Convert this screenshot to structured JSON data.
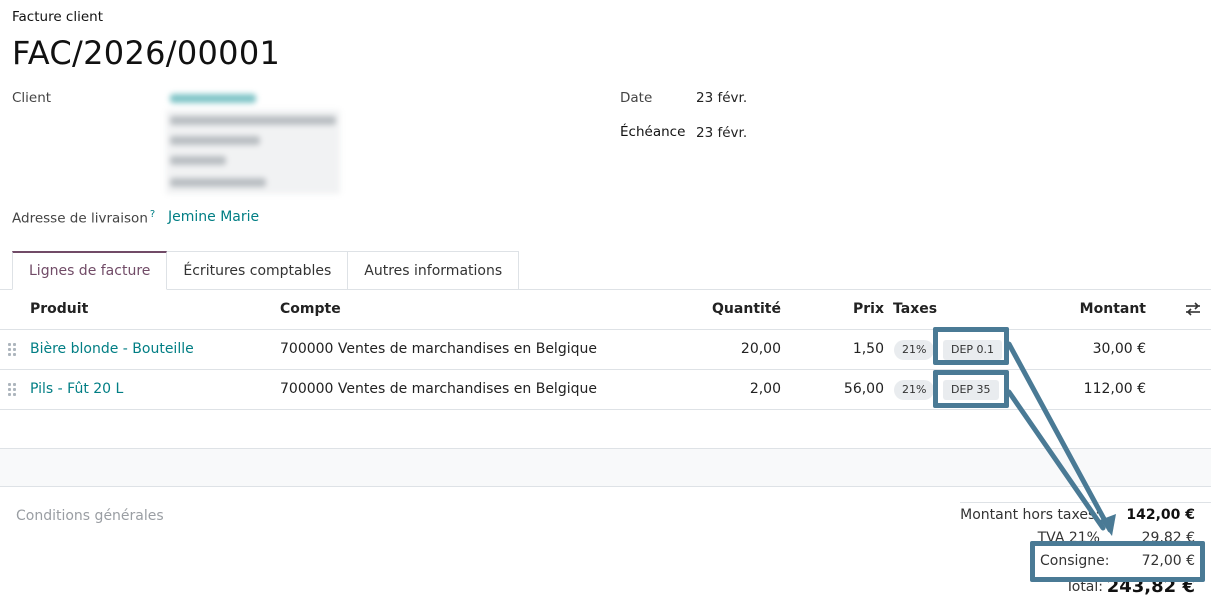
{
  "header": {
    "doc_type": "Facture client",
    "title": "FAC/2026/00001"
  },
  "fields": {
    "client_label": "Client",
    "client_name": "Jemine Marie",
    "date_label": "Date",
    "date_value": "23 févr.",
    "due_label": "Échéance",
    "due_value": "23 févr.",
    "delivery_label": "Adresse de livraison",
    "delivery_help": "?",
    "delivery_value": "Jemine Marie"
  },
  "tabs": [
    {
      "label": "Lignes de facture",
      "active": true
    },
    {
      "label": "Écritures comptables",
      "active": false
    },
    {
      "label": "Autres informations",
      "active": false
    }
  ],
  "table": {
    "columns": {
      "product": "Produit",
      "account": "Compte",
      "quantity": "Quantité",
      "price": "Prix",
      "taxes": "Taxes",
      "amount": "Montant"
    },
    "rows": [
      {
        "product": "Bière blonde - Bouteille",
        "account": "700000 Ventes de marchandises en Belgique",
        "quantity": "20,00",
        "price": "1,50",
        "tax": "21%",
        "deposit": "DEP 0.1",
        "amount": "30,00 €"
      },
      {
        "product": "Pils - Fût 20 L",
        "account": "700000 Ventes de marchandises en Belgique",
        "quantity": "2,00",
        "price": "56,00",
        "tax": "21%",
        "deposit": "DEP 35",
        "amount": "112,00 €"
      }
    ]
  },
  "footer": {
    "conditions_placeholder": "Conditions générales"
  },
  "totals": {
    "untaxed_label": "Montant hors taxes:",
    "untaxed_value": "142,00 €",
    "vat_label": "TVA 21%",
    "vat_value": "29,82 €",
    "deposit_label": "Consigne:",
    "deposit_value": "72,00 €",
    "total_label": "Total:",
    "total_value": "243,82 €"
  },
  "colors": {
    "link": "#017e84",
    "highlight": "#4a7a95",
    "tab_accent": "#714b67"
  }
}
